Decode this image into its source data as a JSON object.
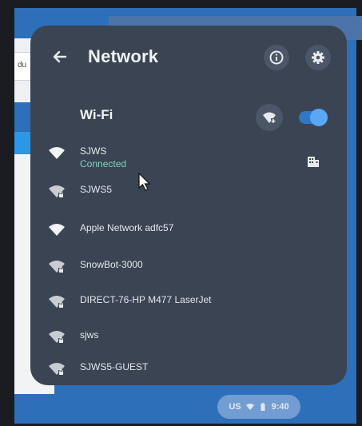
{
  "background": {
    "field_text": "du"
  },
  "header": {
    "title": "Network",
    "back_icon": "arrow-left-icon",
    "info_icon": "info-icon",
    "settings_icon": "gear-icon"
  },
  "wifi": {
    "label": "Wi-Fi",
    "enabled": true,
    "add_icon": "wifi-add-icon"
  },
  "networks": [
    {
      "name": "SJWS",
      "status": "Connected",
      "secured": false,
      "enterprise": true
    },
    {
      "name": "SJWS5",
      "status": "",
      "secured": true,
      "enterprise": false
    },
    {
      "name": "Apple Network adfc57",
      "status": "",
      "secured": false,
      "enterprise": false
    },
    {
      "name": "SnowBot-3000",
      "status": "",
      "secured": true,
      "enterprise": false
    },
    {
      "name": "DIRECT-76-HP M477 LaserJet",
      "status": "",
      "secured": true,
      "enterprise": false
    },
    {
      "name": "sjws",
      "status": "",
      "secured": true,
      "enterprise": false
    },
    {
      "name": "SJWS5-GUEST",
      "status": "",
      "secured": true,
      "enterprise": false
    }
  ],
  "tray": {
    "locale": "US",
    "time": "9:40"
  },
  "colors": {
    "panel": "#3a4453",
    "accent": "#2f78c8",
    "connected": "#7fd6b8"
  }
}
